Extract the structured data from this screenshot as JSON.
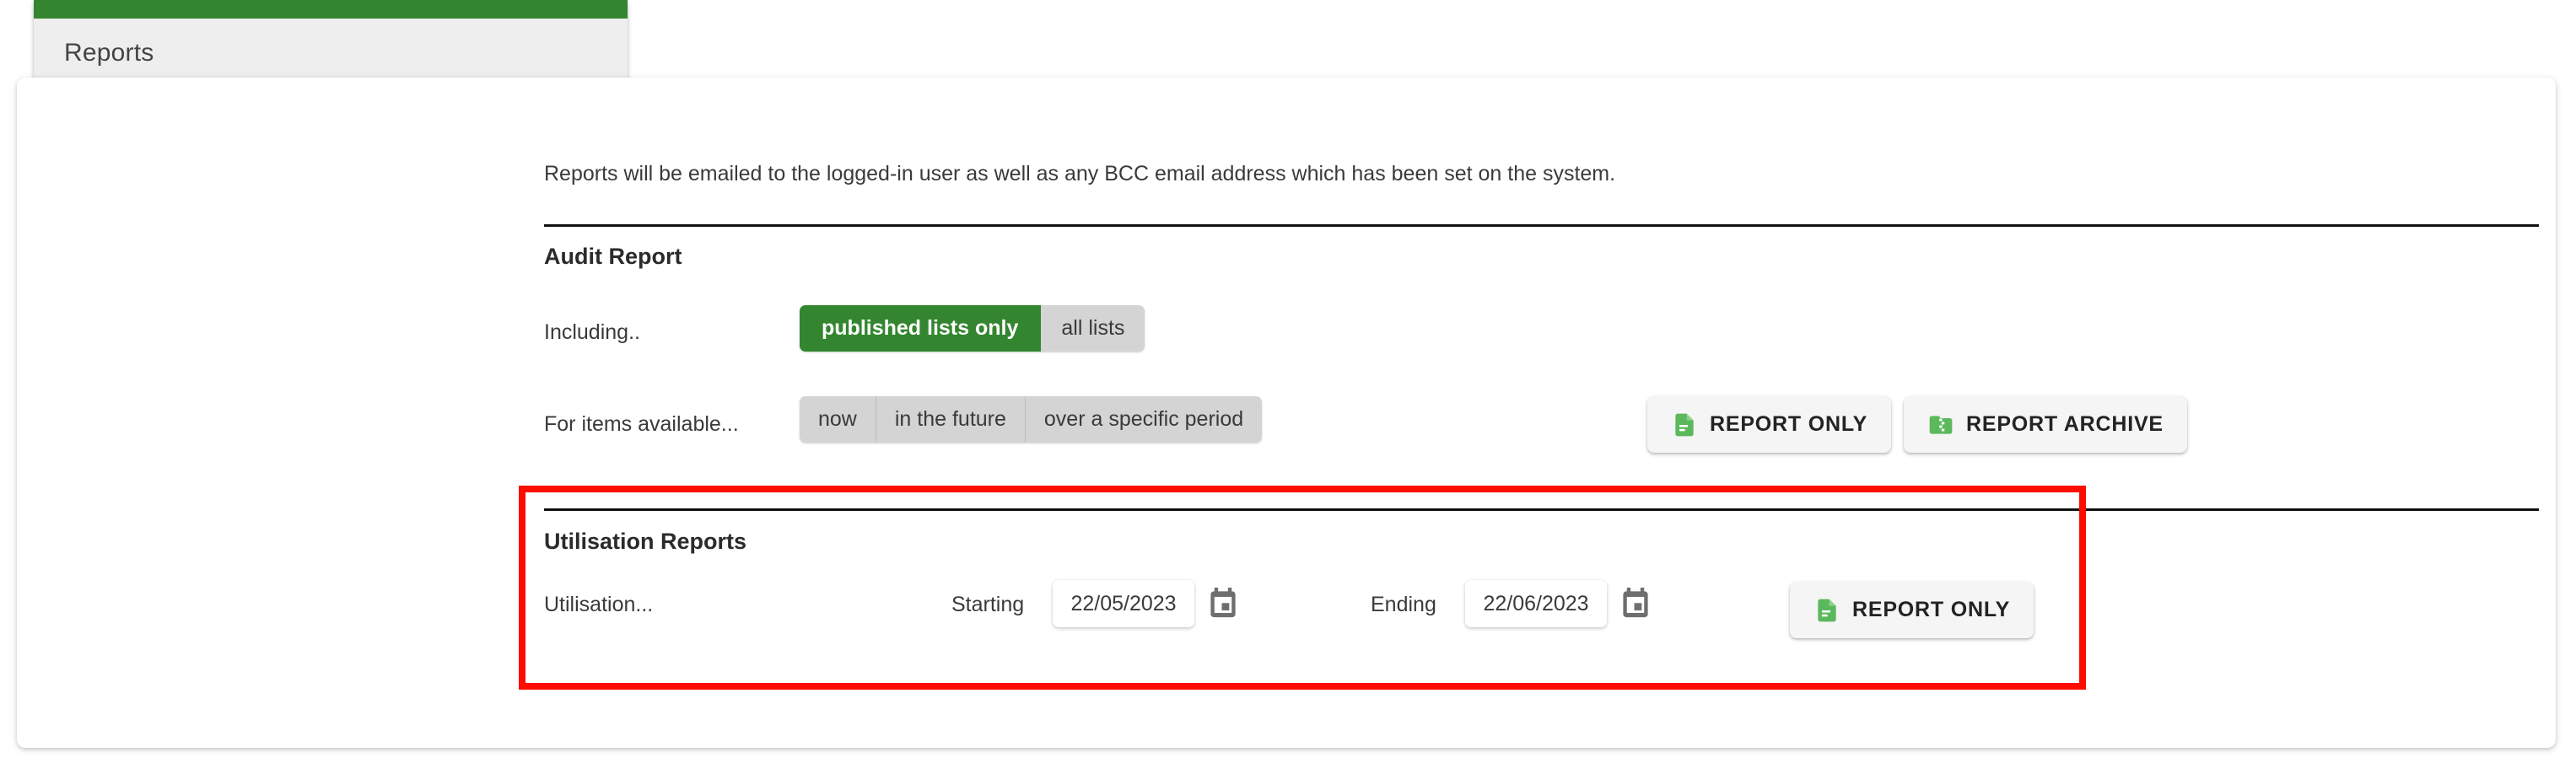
{
  "tab": {
    "label": "Reports",
    "accent_color": "#33862f"
  },
  "intro": {
    "text": "Reports will be emailed to the logged-in user as well as any BCC email address which has been set on the system."
  },
  "audit_section": {
    "heading": "Audit Report",
    "including": {
      "label": "Including..",
      "options": [
        {
          "label": "published lists only",
          "selected": true
        },
        {
          "label": "all lists",
          "selected": false
        }
      ]
    },
    "availability": {
      "label": "For items available...",
      "options": [
        {
          "label": "now",
          "selected": false
        },
        {
          "label": "in the future",
          "selected": false
        },
        {
          "label": "over a specific period",
          "selected": false
        }
      ]
    },
    "buttons": [
      {
        "label": "REPORT ONLY",
        "icon": "document-icon"
      },
      {
        "label": "REPORT ARCHIVE",
        "icon": "folder-zip-icon"
      }
    ]
  },
  "utilisation_section": {
    "heading": "Utilisation Reports",
    "row_label": "Utilisation...",
    "starting": {
      "label": "Starting",
      "value": "22/05/2023",
      "placeholder": "dd/mm/yyyy",
      "calendar_icon": "calendar-icon"
    },
    "ending": {
      "label": "Ending",
      "value": "22/06/2023",
      "placeholder": "dd/mm/yyyy",
      "calendar_icon": "calendar-icon"
    },
    "button": {
      "label": "REPORT ONLY",
      "icon": "document-icon"
    }
  },
  "highlight": {
    "color": "#fc0d00"
  },
  "colors": {
    "brand_green": "#33862f",
    "icon_green": "#5cb85c",
    "toggle_inactive": "#d4d4d4",
    "text": "#3a3a3a"
  }
}
